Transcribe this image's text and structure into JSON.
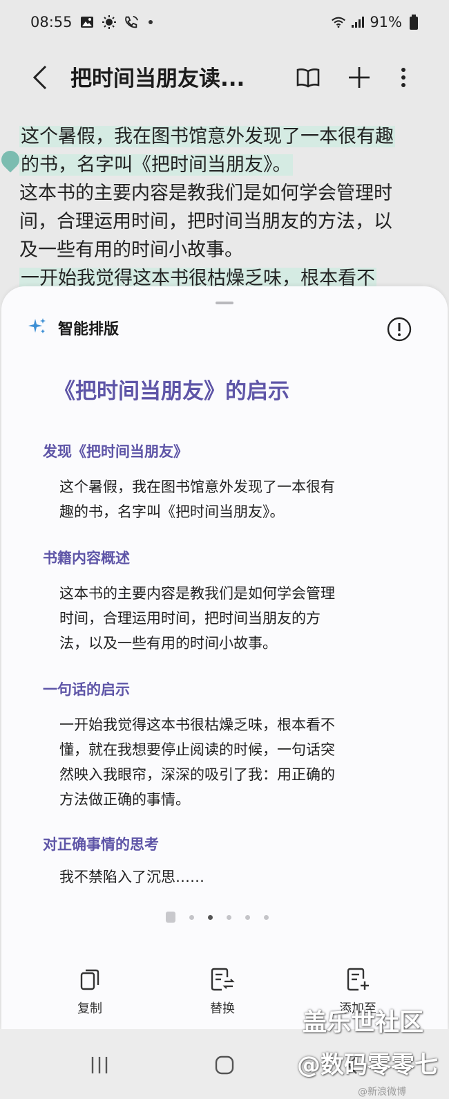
{
  "status_bar": {
    "time": "08:55",
    "battery": "91%",
    "icons": [
      "gallery-icon",
      "brightness-icon",
      "wifi-call-icon",
      "notification-dot",
      "wifi-icon",
      "signal-icon",
      "battery-icon"
    ]
  },
  "app_bar": {
    "title": "把时间当朋友读...",
    "icons": [
      "back-icon",
      "reader-mode-icon",
      "add-icon",
      "more-icon"
    ]
  },
  "document": {
    "lines": [
      "这个暑假，我在图书馆意外发现了一本很有趣",
      "的书，名字叫《把时间当朋友》。",
      "这本书的主要内容是教我们是如何学会管理时",
      "间，合理运用时间，把时间当朋友的方法，以",
      "及一些有用的时间小故事。",
      "一开始我觉得这本书很枯燥乏味，根本看不"
    ],
    "highlight_color": "#d5ebe3"
  },
  "sheet": {
    "header_title": "智能排版",
    "main_title": "《把时间当朋友》的启示",
    "sections": [
      {
        "heading": "发现《把时间当朋友》",
        "lines": [
          "这个暑假，我在图书馆意外发现了一本很有",
          "趣的书，名字叫《把时间当朋友》。"
        ]
      },
      {
        "heading": "书籍内容概述",
        "lines": [
          "这本书的主要内容是教我们是如何学会管理",
          "时间，合理运用时间，把时间当朋友的方",
          "法，以及一些有用的时间小故事。"
        ]
      },
      {
        "heading": "一句话的启示",
        "lines": [
          "一开始我觉得这本书很枯燥乏味，根本看不",
          "懂，就在我想要停止阅读的时候，一句话突",
          "然映入我眼帘，深深的吸引了我：用正确的",
          "方法做正确的事情。"
        ]
      },
      {
        "heading": "对正确事情的思考",
        "lines": [
          "我不禁陷入了沉思……"
        ]
      }
    ],
    "pager": {
      "pages": 6,
      "active_index": 2
    },
    "actions": [
      {
        "label": "复制",
        "icon": "copy-icon"
      },
      {
        "label": "替换",
        "icon": "replace-icon"
      },
      {
        "label": "添加至",
        "icon": "add-to-note-icon"
      }
    ],
    "accent_color": "#5e55a7"
  },
  "nav_bar": {
    "icons": [
      "recent-apps-icon",
      "home-icon",
      "back-nav-icon"
    ]
  },
  "watermark": {
    "line1": "盖乐世社区",
    "line2": "@数码零零七",
    "line3": "@新浪微博"
  }
}
